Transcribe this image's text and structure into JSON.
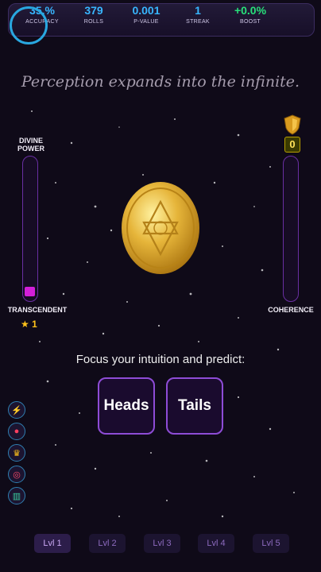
{
  "stats": [
    {
      "value": "35.",
      "suffix": "%",
      "label": "ACCURACY",
      "color": "#38b6ff"
    },
    {
      "value": "379",
      "label": "ROLLS",
      "color": "#38b6ff"
    },
    {
      "value": "0.001",
      "label": "P-VALUE",
      "color": "#38b6ff"
    },
    {
      "value": "1",
      "label": "STREAK",
      "color": "#38b6ff"
    },
    {
      "value": "+0.0%",
      "label": "BOOST",
      "color": "#28e07a"
    }
  ],
  "tagline": "Perception expands into the infinite.",
  "left_meter": {
    "title_line1": "DIVINE",
    "title_line2": "POWER",
    "level_label": "TRANSCENDENT",
    "stars": "1",
    "fill_fraction": 0.06,
    "color": "#d21fd8"
  },
  "right_meter": {
    "label": "COHERENCE",
    "shield_count": "0"
  },
  "coin": {
    "face": "star-of-david"
  },
  "prompt": "Focus your intuition and predict:",
  "choices": {
    "heads": "Heads",
    "tails": "Tails"
  },
  "side_icons": [
    "lightning-icon",
    "flame-icon",
    "crown-icon",
    "target-icon",
    "chart-icon"
  ],
  "levels": [
    "Lvl 1",
    "Lvl 2",
    "Lvl 3",
    "Lvl 4",
    "Lvl 5"
  ],
  "active_level": 0
}
